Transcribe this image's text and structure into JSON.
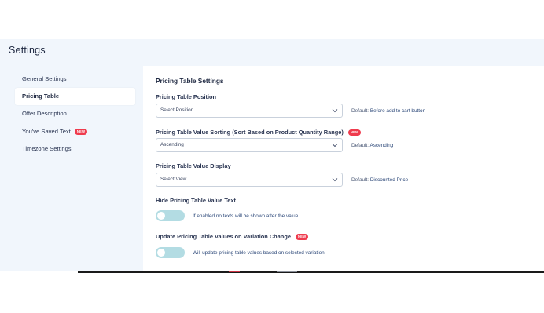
{
  "page": {
    "title": "Settings"
  },
  "sidebar": {
    "items": [
      {
        "label": "General Settings",
        "active": false,
        "badge": ""
      },
      {
        "label": "Pricing Table",
        "active": true,
        "badge": ""
      },
      {
        "label": "Offer Description",
        "active": false,
        "badge": ""
      },
      {
        "label": "You've Saved Text",
        "active": false,
        "badge": "NEW"
      },
      {
        "label": "Timezone Settings",
        "active": false,
        "badge": ""
      }
    ]
  },
  "main": {
    "section_title": "Pricing Table Settings",
    "position": {
      "label": "Pricing Table Position",
      "value": "Select Position",
      "default_prefix": "Default:",
      "default_value": "Before add to cart button"
    },
    "sorting": {
      "label": "Pricing Table Value Sorting (Sort Based on Product Quantity Range)",
      "badge": "NEW",
      "value": "Ascending",
      "default_prefix": "Default:",
      "default_value": "Ascending"
    },
    "display": {
      "label": "Pricing Table Value Display",
      "value": "Select View",
      "default_prefix": "Default:",
      "default_value": "Discounted Price"
    },
    "hide_text": {
      "label": "Hide Pricing Table Value Text",
      "enabled": false,
      "help": "If enabled no texts will be shown after the value"
    },
    "variation_update": {
      "label": "Update Pricing Table Values on Variation Change",
      "badge": "NEW",
      "enabled": false,
      "help": "Will update pricing table values based on selected variation"
    }
  },
  "colors": {
    "page_bg": "#f1f6fc",
    "badge": "#ef3b4d",
    "toggle_off": "#b3dce3",
    "link_text": "#2b4778"
  }
}
